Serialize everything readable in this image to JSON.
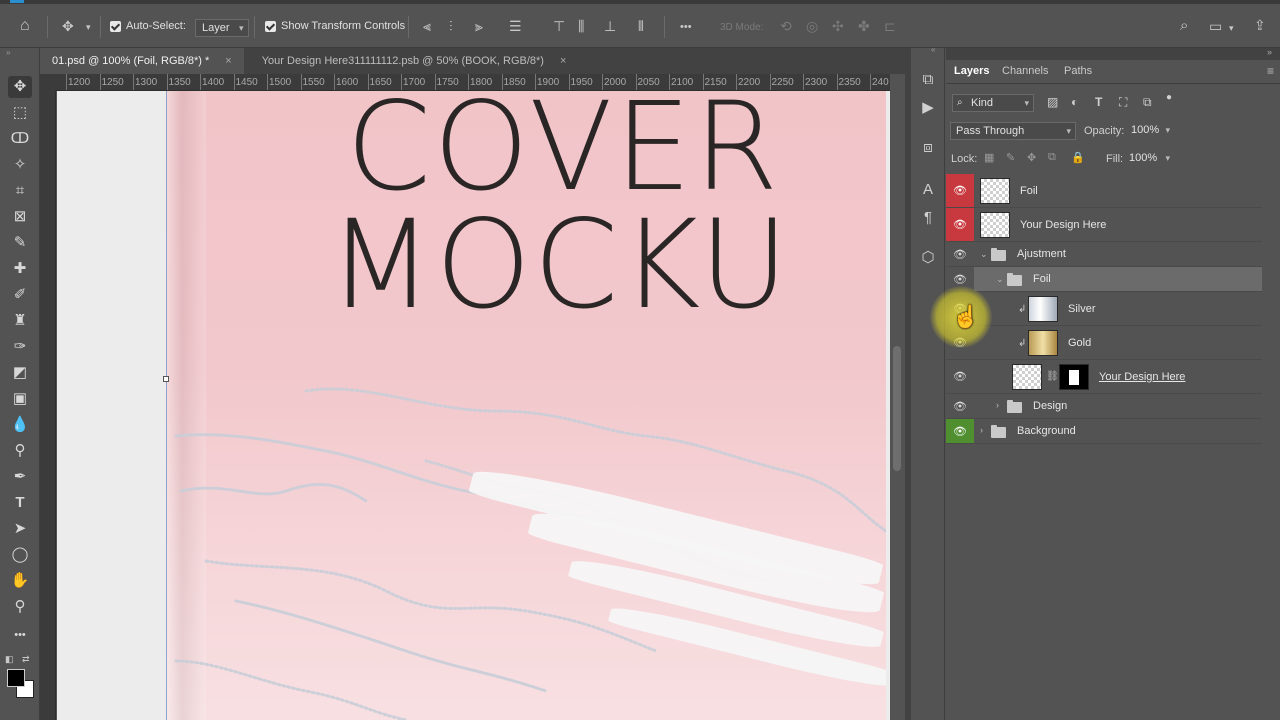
{
  "options_bar": {
    "auto_select_label": "Auto-Select:",
    "auto_select_target": "Layer",
    "show_transform_label": "Show Transform Controls",
    "mode_3d_label": "3D Mode:",
    "more_label": "•••"
  },
  "tabs": [
    {
      "label": "01.psd @ 100% (Foil, RGB/8*) *",
      "close": "×"
    },
    {
      "label": "Your Design Here311111112.psb @ 50% (BOOK, RGB/8*)",
      "close": "×"
    }
  ],
  "ruler": {
    "ticks": [
      "1200",
      "1250",
      "1300",
      "1350",
      "1400",
      "1450",
      "1500",
      "1550",
      "1600",
      "1650",
      "1700",
      "1750",
      "1800",
      "1850",
      "1900",
      "1950",
      "2000",
      "2050",
      "2100",
      "2150",
      "2200",
      "2250",
      "2300",
      "2350",
      "240"
    ]
  },
  "canvas": {
    "title_line1": "COVER",
    "title_line2": "MOCKU",
    "cover_color": "#f2c6ca"
  },
  "panel": {
    "tabs": [
      "Layers",
      "Channels",
      "Paths"
    ],
    "filter_kind": "Kind",
    "blend_mode": "Pass Through",
    "opacity_label": "Opacity:",
    "opacity_value": "100%",
    "lock_label": "Lock:",
    "fill_label": "Fill:",
    "fill_value": "100%"
  },
  "layers": [
    {
      "name": "Foil",
      "eye": "red"
    },
    {
      "name": "Your Design Here",
      "eye": "red"
    },
    {
      "name": "Ajustment",
      "eye": "normal"
    },
    {
      "name": "Foil",
      "eye": "normal"
    },
    {
      "name": "Silver",
      "eye": "normal"
    },
    {
      "name": "Gold",
      "eye": "normal"
    },
    {
      "name": "Your Design Here ",
      "eye": "normal"
    },
    {
      "name": "Design",
      "eye": "normal"
    },
    {
      "name": "Background",
      "eye": "green"
    }
  ],
  "colors": {
    "accent_red": "#c8393f",
    "accent_green": "#4f8f2f",
    "cursor_highlight": "#e3d83c"
  }
}
